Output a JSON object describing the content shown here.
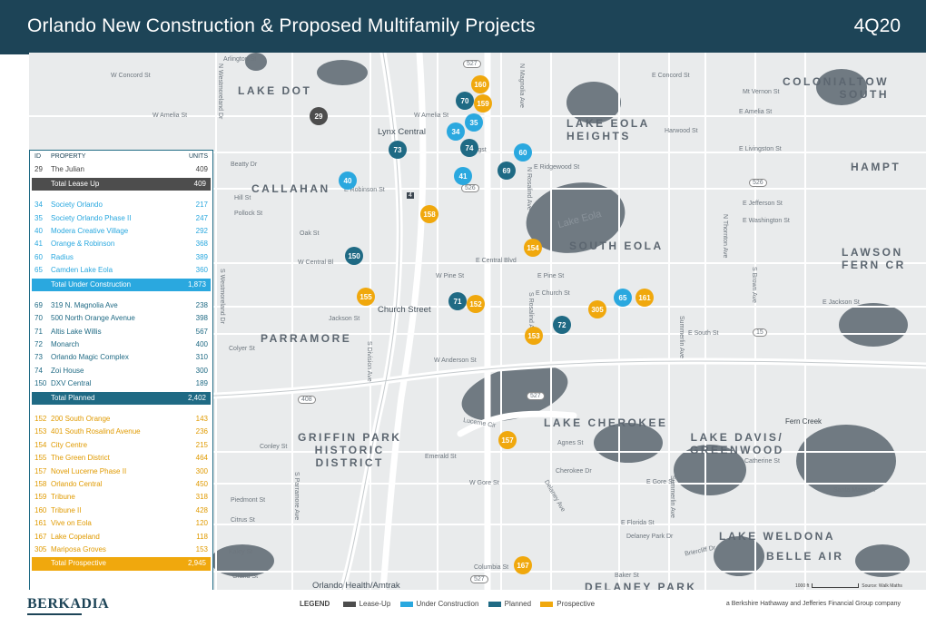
{
  "header": {
    "title": "Orlando New Construction & Proposed Multifamily Projects",
    "period": "4Q20"
  },
  "colors": {
    "header_bg": "#1d4457",
    "lease_up": "#4d4d4d",
    "under_construction": "#2aa8df",
    "planned": "#1f6a84",
    "prospective": "#f0a80d"
  },
  "districts": {
    "lake_dot": "LAKE DOT",
    "colonialtown_south": "COLONIALTOW\nSOUTH",
    "lake_eola_heights": "LAKE EOLA\nHEIGHTS",
    "hampt": "HAMPT",
    "callahan": "CALLAHAN",
    "south_eola": "SOUTH EOLA",
    "lawson_fern": "LAWSON\nFERN CR",
    "parramore": "PARRAMORE",
    "griffin_park": "GRIFFIN PARK\nHISTORIC\nDISTRICT",
    "lake_cherokee": "LAKE CHEROKEE",
    "lake_davis": "LAKE DAVIS/\nGREENWOOD",
    "lake_weldona": "LAKE WELDONA",
    "belle_air": "BELLE AIR",
    "delaney_park": "DELANEY PARK"
  },
  "lakes": {
    "lake_eola": "Lake Eola",
    "fern_creek": "Fern Creek"
  },
  "stations": {
    "lynx": "Lynx Central",
    "church": "Church Street",
    "orlando_health": "Orlando Health/Amtrak"
  },
  "streets": {
    "livingston": "Livingst",
    "e_livingston": "E Livingston St",
    "central": "W Central Bl",
    "e_central": "E Central Blvd",
    "w_amelia": "W Amelia St",
    "e_amelia": "E Amelia St",
    "w_amelia2": "W Amelia St",
    "south": "E South St",
    "w_anderson": "W Anderson St",
    "w_gore": "W Gore St",
    "e_gore": "E Gore St",
    "robinson": "E Robinson St",
    "n_magnolia": "N Magnolia Ave",
    "n_westmoreland": "N Westmoreland Dr",
    "s_westmoreland": "S Westmoreland Dr",
    "s_division": "S Division Ave",
    "n_rosalind": "N Rosalind Ave",
    "s_rosalind": "S Rosalind Ave",
    "summerlin": "Summerlin Ave",
    "s_parramore": "S Parramore Ave",
    "delaney": "Delaney Ave",
    "n_thornton": "N Thornton Ave",
    "s_brown": "S Brown Ave",
    "e_concord": "E Concord St",
    "concord": "W Concord St",
    "mt_vernon": "Mt Vernon St",
    "e_ridgewood": "E Ridgewood St",
    "e_jefferson": "E Jefferson St",
    "e_washington": "E Washington St",
    "e_church": "E Church St",
    "e_jackson": "E Jackson St",
    "w_pine": "W Pine St",
    "e_pine": "E Pine St",
    "harwood": "Harwood St",
    "catherine": "Catherine St",
    "santa_maria": "Santa Maria Pl",
    "briercliff": "Briercliff Dr",
    "columbia": "Columbia St",
    "grand": "Grand St",
    "baker": "Baker St",
    "emerald": "Emerald St",
    "cherokee": "Cherokee Dr",
    "florida": "E Florida St",
    "delaney_park_dr": "Delaney Park Dr",
    "conley": "Conley St",
    "kaley": "Kaley St",
    "lucerne": "Lucerne Cir",
    "agnes": "Agnes St",
    "arlington": "Arlington St",
    "jackson": "Jackson St",
    "oak": "Oak St",
    "pollock": "Pollock St",
    "beatty": "Beatty Dr",
    "colyer": "Colyer St",
    "citrus": "Citrus St",
    "piedmont": "Piedmont St",
    "hill": "Hill St",
    "boone": "Boone Ave",
    "osceola": "Osceola St",
    "highway_527": "527",
    "highway_408": "408",
    "highway_526": "526",
    "highway_15": "15",
    "highway_4": "4"
  },
  "markers": [
    {
      "id": "160",
      "status": "prospective"
    },
    {
      "id": "70",
      "status": "planned"
    },
    {
      "id": "159",
      "status": "prospective"
    },
    {
      "id": "29",
      "status": "lease_up"
    },
    {
      "id": "35",
      "status": "under_construction"
    },
    {
      "id": "34",
      "status": "under_construction"
    },
    {
      "id": "74",
      "status": "planned"
    },
    {
      "id": "73",
      "status": "planned"
    },
    {
      "id": "60",
      "status": "under_construction"
    },
    {
      "id": "69",
      "status": "planned"
    },
    {
      "id": "41",
      "status": "under_construction"
    },
    {
      "id": "40",
      "status": "under_construction"
    },
    {
      "id": "158",
      "status": "prospective"
    },
    {
      "id": "154",
      "status": "prospective"
    },
    {
      "id": "150",
      "status": "planned"
    },
    {
      "id": "155",
      "status": "prospective"
    },
    {
      "id": "71",
      "status": "planned"
    },
    {
      "id": "152",
      "status": "prospective"
    },
    {
      "id": "65",
      "status": "under_construction"
    },
    {
      "id": "161",
      "status": "prospective"
    },
    {
      "id": "305",
      "status": "prospective"
    },
    {
      "id": "72",
      "status": "planned"
    },
    {
      "id": "153",
      "status": "prospective"
    },
    {
      "id": "157",
      "status": "prospective"
    },
    {
      "id": "167",
      "status": "prospective"
    }
  ],
  "table": {
    "headers": {
      "id": "ID",
      "property": "PROPERTY",
      "units": "UNITS"
    },
    "groups": [
      {
        "status": "lease_up",
        "rows": [
          {
            "id": "29",
            "name": "The Julian",
            "units": "409"
          }
        ],
        "total": {
          "label": "Total Lease Up",
          "units": "409"
        }
      },
      {
        "status": "under_construction",
        "rows": [
          {
            "id": "34",
            "name": "Society Orlando",
            "units": "217"
          },
          {
            "id": "35",
            "name": "Society Orlando Phase II",
            "units": "247"
          },
          {
            "id": "40",
            "name": "Modera Creative Village",
            "units": "292"
          },
          {
            "id": "41",
            "name": "Orange & Robinson",
            "units": "368"
          },
          {
            "id": "60",
            "name": "Radius",
            "units": "389"
          },
          {
            "id": "65",
            "name": "Camden Lake Eola",
            "units": "360"
          }
        ],
        "total": {
          "label": "Total Under Construction",
          "units": "1,873"
        }
      },
      {
        "status": "planned",
        "rows": [
          {
            "id": "69",
            "name": "319 N. Magnolia Ave",
            "units": "238"
          },
          {
            "id": "70",
            "name": "500 North Orange Avenue",
            "units": "398"
          },
          {
            "id": "71",
            "name": "Altis Lake Willis",
            "units": "567"
          },
          {
            "id": "72",
            "name": "Monarch",
            "units": "400"
          },
          {
            "id": "73",
            "name": "Orlando Magic Complex",
            "units": "310"
          },
          {
            "id": "74",
            "name": "Zoi House",
            "units": "300"
          },
          {
            "id": "150",
            "name": "DXV Central",
            "units": "189"
          }
        ],
        "total": {
          "label": "Total Planned",
          "units": "2,402"
        }
      },
      {
        "status": "prospective",
        "rows": [
          {
            "id": "152",
            "name": "200 South Orange",
            "units": "143"
          },
          {
            "id": "153",
            "name": "401 South Rosalind Avenue",
            "units": "236"
          },
          {
            "id": "154",
            "name": "City Centre",
            "units": "215"
          },
          {
            "id": "155",
            "name": "The Green District",
            "units": "464"
          },
          {
            "id": "157",
            "name": "Novel Lucerne Phase II",
            "units": "300"
          },
          {
            "id": "158",
            "name": "Orlando Central",
            "units": "450"
          },
          {
            "id": "159",
            "name": "Tribune",
            "units": "318"
          },
          {
            "id": "160",
            "name": "Tribune II",
            "units": "428"
          },
          {
            "id": "161",
            "name": "Vive on Eola",
            "units": "120"
          },
          {
            "id": "167",
            "name": "Lake Copeland",
            "units": "118"
          },
          {
            "id": "305",
            "name": "Mariposa Groves",
            "units": "153"
          }
        ],
        "total": {
          "label": "Total Prospective",
          "units": "2,945"
        }
      }
    ]
  },
  "footer": {
    "logo": "BERKADIA",
    "legend_title": "LEGEND",
    "legend": {
      "lease_up": "Lease-Up",
      "under_construction": "Under Construction",
      "planned": "Planned",
      "prospective": "Prospective"
    },
    "tagline": "a Berkshire Hathaway and Jefferies Financial Group company",
    "scale_label": "1000 ft",
    "source": "Source: Walk Maths"
  }
}
